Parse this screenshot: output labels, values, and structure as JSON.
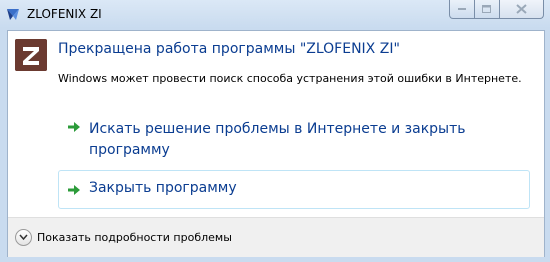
{
  "window": {
    "title": "ZLOFENIX ZI"
  },
  "dialog": {
    "heading": "Прекращена работа программы \"ZLOFENIX ZI\"",
    "description": "Windows может провести поиск способа устранения этой ошибки в Интернете.",
    "options": [
      {
        "label": "Искать решение проблемы в Интернете и закрыть программу"
      },
      {
        "label": "Закрыть программу"
      }
    ],
    "footer": {
      "details_label": "Показать подробности проблемы"
    }
  },
  "colors": {
    "link_blue": "#0b3d91",
    "arrow_green": "#2c9b3a",
    "app_icon_bg": "#6b3a30"
  },
  "icons": {
    "title_icon": "app-small-icon",
    "app_icon": "z-logo-icon",
    "option_icon": "green-arrow-icon",
    "details_icon": "chevron-down-icon"
  }
}
